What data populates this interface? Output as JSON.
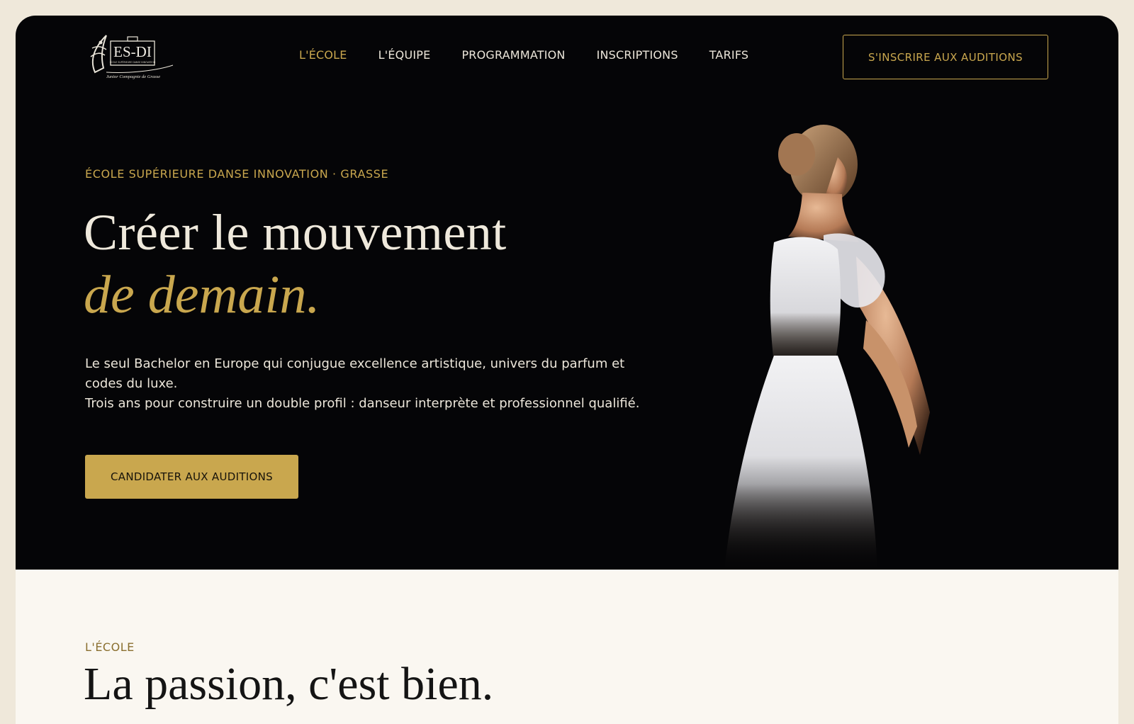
{
  "logo": {
    "mark": "ES-DI",
    "tagline": "ÉCOLE SUPÉRIEURE DANSE INNOVATION",
    "subtitle": "Junior Compagnie de Grasse"
  },
  "nav": {
    "items": [
      "L'ÉCOLE",
      "L'ÉQUIPE",
      "PROGRAMMATION",
      "INSCRIPTIONS",
      "TARIFS"
    ],
    "active_index": 0
  },
  "header_cta": {
    "label": "S'INSCRIRE AUX AUDITIONS"
  },
  "hero": {
    "eyebrow": "ÉCOLE SUPÉRIEURE DANSE INNOVATION · GRASSE",
    "title_line1": "Créer le mouvement",
    "title_line2": "de demain.",
    "paragraph_1": "Le seul Bachelor en Europe qui conjugue excellence artistique, univers du parfum et codes du luxe.",
    "paragraph_2": "Trois ans pour construire un double profil : danseur interprète et professionnel qualifié.",
    "cta_label": "CANDIDATER AUX AUDITIONS"
  },
  "school_section": {
    "eyebrow": "L'ÉCOLE",
    "title": "La passion, c'est bien."
  },
  "colors": {
    "accent_gold": "#c9a74e",
    "hero_background": "#050507",
    "page_background": "#efe8da",
    "section_background": "#faf7f1"
  }
}
